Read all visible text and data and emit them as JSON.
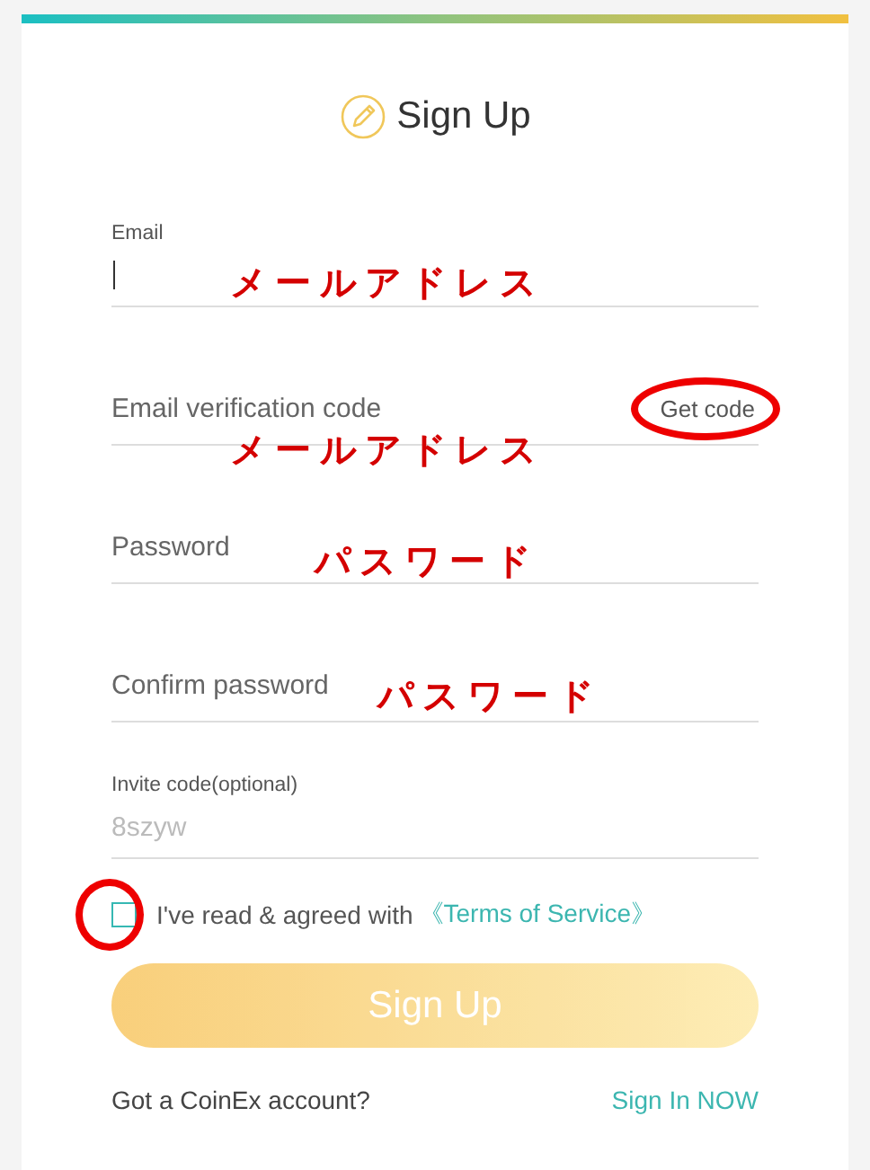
{
  "title": "Sign Up",
  "fields": [
    {
      "kind": "labeled",
      "label": "Email",
      "focused": true,
      "note": "メールアドレス"
    },
    {
      "kind": "plain",
      "placeholder": "Email verification code",
      "action": {
        "label": "Get code",
        "circled": true
      },
      "note": "メールアドレス"
    },
    {
      "kind": "plain",
      "placeholder": "Password",
      "note": "パスワード"
    },
    {
      "kind": "plain",
      "placeholder": "Confirm password",
      "note": "パスワード"
    },
    {
      "kind": "labeled",
      "label": "Invite code(optional)",
      "placeholder": "8szyw"
    }
  ],
  "agreement": {
    "checked": false,
    "circled": true,
    "text": "I've read & agreed with",
    "link": "《Terms of Service》"
  },
  "submit": {
    "label": "Sign Up",
    "disabled": true
  },
  "footer": {
    "text": "Got a CoinEx account?",
    "link": "Sign In NOW"
  }
}
